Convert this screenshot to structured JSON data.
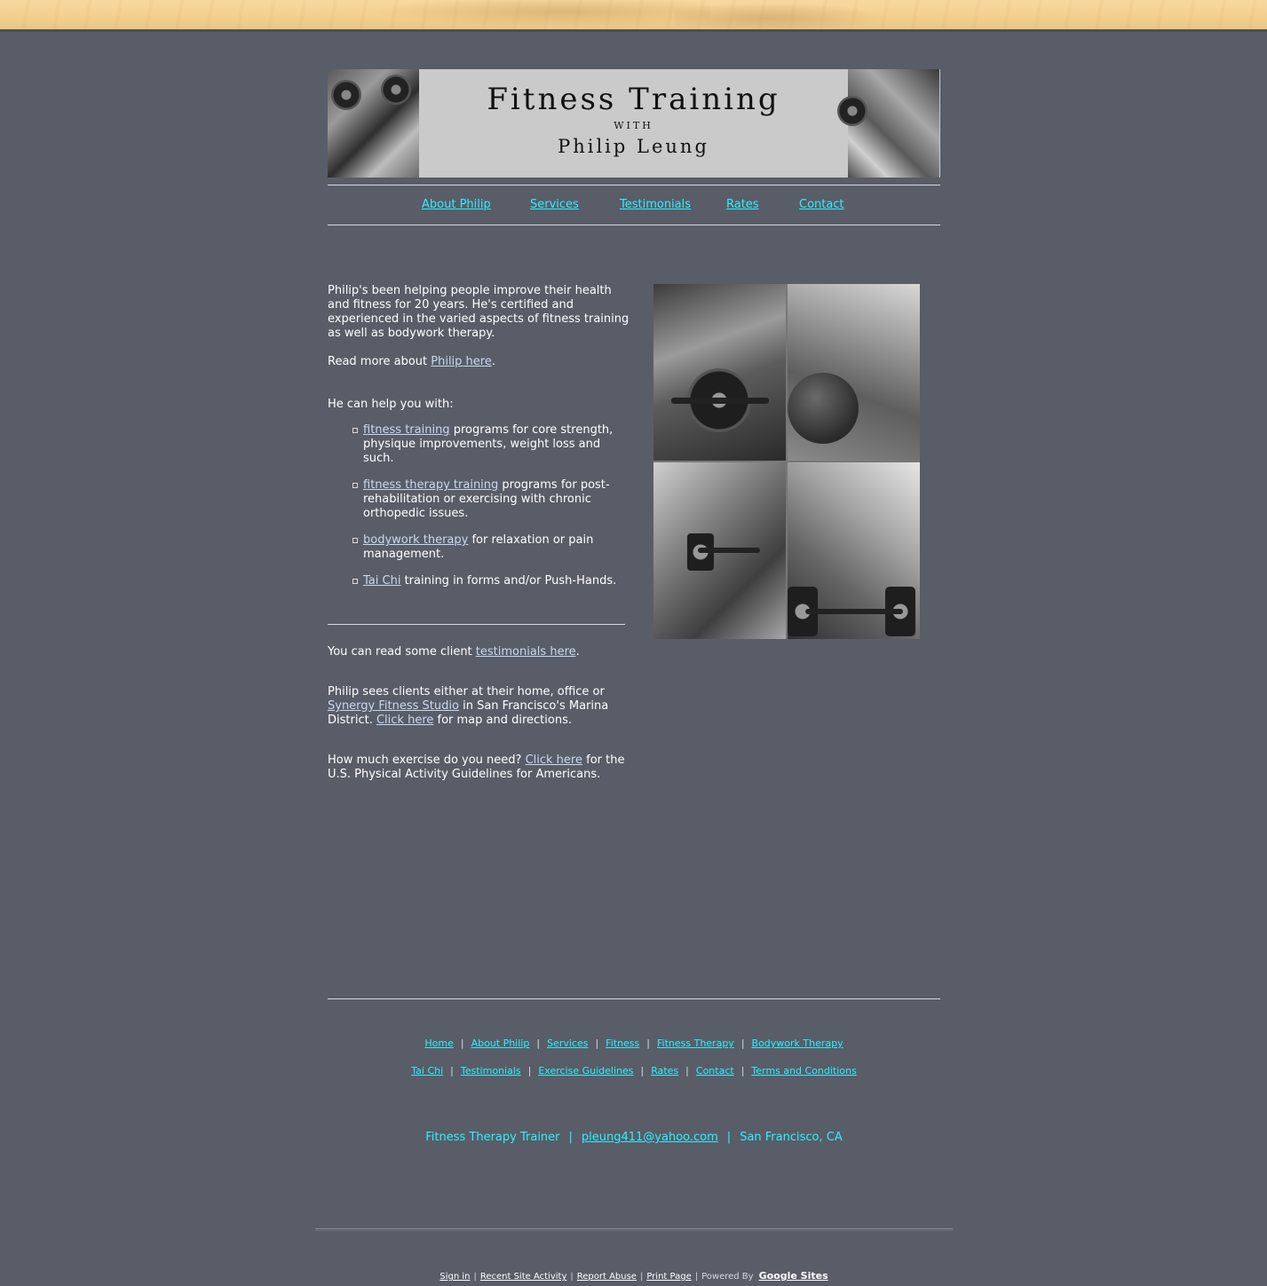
{
  "header": {
    "title_line1": "Fitness Training",
    "title_line2": "WITH",
    "title_line3": "Philip Leung"
  },
  "nav": [
    {
      "label": "About Philip"
    },
    {
      "label": "Services"
    },
    {
      "label": "Testimonials"
    },
    {
      "label": "Rates"
    },
    {
      "label": "Contact"
    }
  ],
  "main": {
    "intro": "Philip's been helping people improve their health and fitness for 20 years. He's certified and experienced in the varied aspects of fitness training as well as bodywork therapy.",
    "read_more_prefix": "Read more about ",
    "read_more_link": "Philip here",
    "read_more_suffix": ".",
    "help_heading": "He can help you with:",
    "services": [
      {
        "link": "fitness training",
        "text": " programs for core strength, physique improvements, weight loss and such."
      },
      {
        "link": "fitness therapy training",
        "text": " programs for post-rehabilitation or exercising with chronic orthopedic issues."
      },
      {
        "link": "bodywork therapy",
        "text": " for relaxation or pain management."
      },
      {
        "link": "Tai Chi",
        "text": " training in forms and/or Push-Hands."
      }
    ],
    "testimonials_prefix": "You can read some client ",
    "testimonials_link": "testimonials here",
    "testimonials_suffix": ".",
    "location_prefix": "Philip sees clients either at their home, office or ",
    "location_link1": "Synergy Fitness Studio",
    "location_mid": " in San Francisco's Marina District. ",
    "location_link2": "Click here",
    "location_suffix": " for map and directions.",
    "exercise_prefix": "How much exercise do you need?  ",
    "exercise_link": "Click here",
    "exercise_suffix": " for the U.S. Physical Activity Guidelines for Americans."
  },
  "footer_row1": [
    "Home",
    "About Philip",
    "Services",
    "Fitness",
    "Fitness Therapy",
    "Bodywork Therapy"
  ],
  "footer_row2": [
    "Tai Chi",
    "Testimonials",
    "Exercise Guidelines",
    "Rates",
    "Contact",
    "Terms and Conditions"
  ],
  "contact": {
    "role": "Fitness Therapy Trainer",
    "email": "pleung411@yahoo.com",
    "location": "San Francisco, CA"
  },
  "google_sites": {
    "sign_in": "Sign in",
    "recent_activity": "Recent Site Activity",
    "report_abuse": "Report Abuse",
    "print_page": "Print Page",
    "powered_by": "Powered By",
    "brand": "Google Sites"
  },
  "colors": {
    "background": "#585d68",
    "link_cyan": "#2ef0ff",
    "link_light": "#c9d8f0",
    "header_gray": "#cacaca"
  }
}
